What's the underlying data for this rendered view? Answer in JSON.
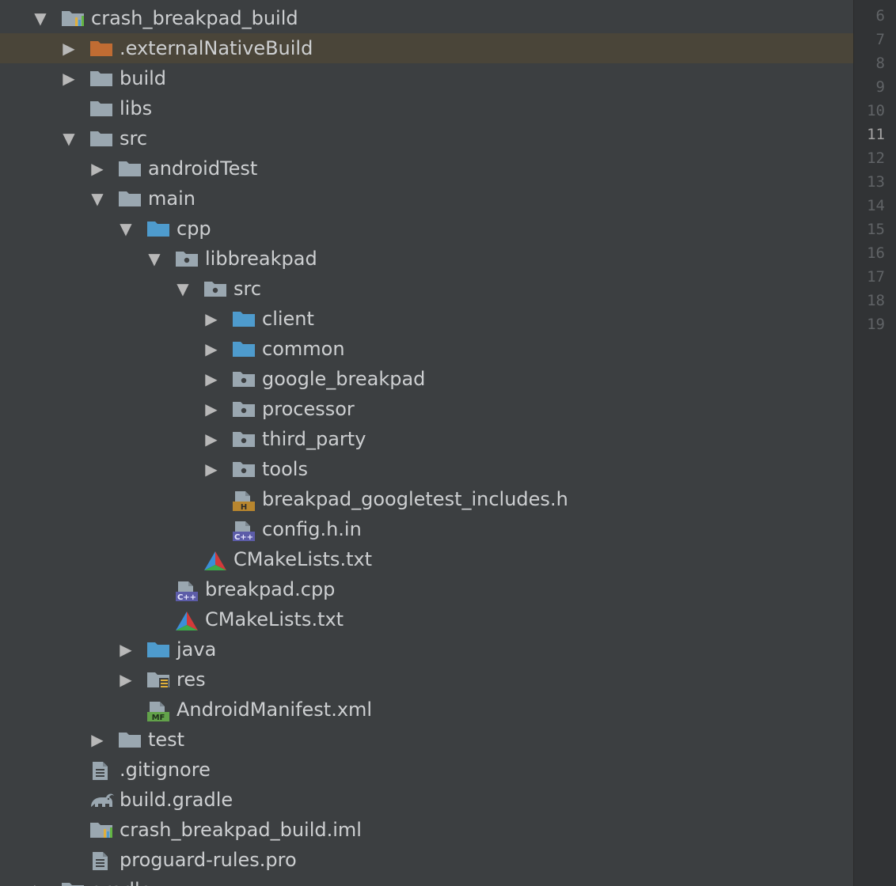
{
  "project_tree": {
    "items": [
      {
        "label": "crash_breakpad_build",
        "depth": 0,
        "expanded": true,
        "icon": "module-icon"
      },
      {
        "label": ".externalNativeBuild",
        "depth": 1,
        "expanded": false,
        "icon": "folder-excluded-icon",
        "selected": true
      },
      {
        "label": "build",
        "depth": 1,
        "expanded": false,
        "icon": "folder-icon"
      },
      {
        "label": "libs",
        "depth": 1,
        "icon": "folder-icon"
      },
      {
        "label": "src",
        "depth": 1,
        "expanded": true,
        "icon": "folder-icon"
      },
      {
        "label": "androidTest",
        "depth": 2,
        "expanded": false,
        "icon": "folder-icon"
      },
      {
        "label": "main",
        "depth": 2,
        "expanded": true,
        "icon": "folder-icon"
      },
      {
        "label": "cpp",
        "depth": 3,
        "expanded": true,
        "icon": "source-folder-icon"
      },
      {
        "label": "libbreakpad",
        "depth": 4,
        "expanded": true,
        "icon": "package-folder-icon"
      },
      {
        "label": "src",
        "depth": 5,
        "expanded": true,
        "icon": "package-folder-icon"
      },
      {
        "label": "client",
        "depth": 6,
        "expanded": false,
        "icon": "source-folder-icon"
      },
      {
        "label": "common",
        "depth": 6,
        "expanded": false,
        "icon": "source-folder-icon"
      },
      {
        "label": "google_breakpad",
        "depth": 6,
        "expanded": false,
        "icon": "package-folder-icon"
      },
      {
        "label": "processor",
        "depth": 6,
        "expanded": false,
        "icon": "package-folder-icon"
      },
      {
        "label": "third_party",
        "depth": 6,
        "expanded": false,
        "icon": "package-folder-icon"
      },
      {
        "label": "tools",
        "depth": 6,
        "expanded": false,
        "icon": "package-folder-icon"
      },
      {
        "label": "breakpad_googletest_includes.h",
        "depth": 6,
        "icon": "header-file-icon"
      },
      {
        "label": "config.h.in",
        "depth": 6,
        "icon": "cpp-file-icon"
      },
      {
        "label": "CMakeLists.txt",
        "depth": 5,
        "icon": "cmake-icon"
      },
      {
        "label": "breakpad.cpp",
        "depth": 4,
        "icon": "cpp-file-icon"
      },
      {
        "label": "CMakeLists.txt",
        "depth": 4,
        "icon": "cmake-icon"
      },
      {
        "label": "java",
        "depth": 3,
        "expanded": false,
        "icon": "source-folder-icon"
      },
      {
        "label": "res",
        "depth": 3,
        "expanded": false,
        "icon": "resources-folder-icon"
      },
      {
        "label": "AndroidManifest.xml",
        "depth": 3,
        "icon": "manifest-file-icon"
      },
      {
        "label": "test",
        "depth": 2,
        "expanded": false,
        "icon": "folder-icon"
      },
      {
        "label": ".gitignore",
        "depth": 1,
        "icon": "text-file-icon"
      },
      {
        "label": "build.gradle",
        "depth": 1,
        "icon": "gradle-icon"
      },
      {
        "label": "crash_breakpad_build.iml",
        "depth": 1,
        "icon": "module-icon"
      },
      {
        "label": "proguard-rules.pro",
        "depth": 1,
        "icon": "text-file-icon"
      },
      {
        "label": "gradle",
        "depth": 0,
        "expanded": false,
        "icon": "folder-icon"
      }
    ]
  },
  "gutter": {
    "line_numbers": [
      "6",
      "7",
      "8",
      "9",
      "10",
      "11",
      "12",
      "13",
      "14",
      "15",
      "16",
      "17",
      "18",
      "19"
    ],
    "current_line": "11"
  },
  "colors": {
    "background": "#3c3f41",
    "selected_row": "#4a4539",
    "text": "#cdcfd1",
    "folder": "#9aa7b0",
    "source_folder": "#4e9bcd",
    "excluded_folder": "#c06c33"
  }
}
